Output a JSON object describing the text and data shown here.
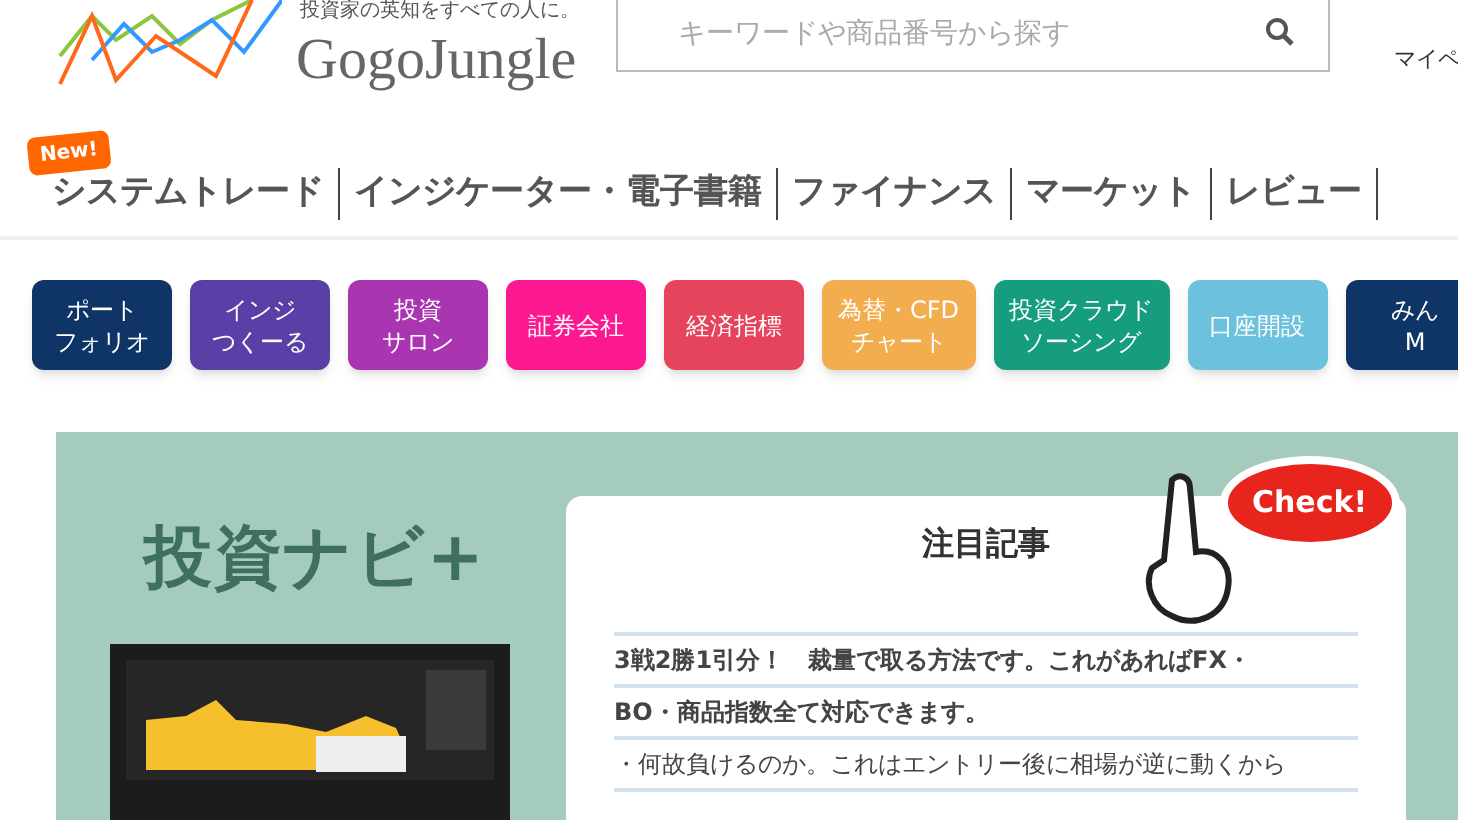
{
  "header": {
    "tagline": "投資家の英知をすべての人に。",
    "logo_text": "GogoJungle",
    "search": {
      "placeholder": "キーワードや商品番号から探す"
    },
    "account_link": "マイペ"
  },
  "nav": {
    "badge": "New!",
    "items": [
      {
        "label": "システムトレード",
        "selected": false
      },
      {
        "label": "インジケーター・電子書籍",
        "selected": false
      },
      {
        "label": "ファイナンス",
        "selected": false
      },
      {
        "label": "マーケット",
        "selected": false
      },
      {
        "label": "レビュー",
        "selected": false
      }
    ]
  },
  "categories": [
    {
      "lines": [
        "ポート",
        "フォリオ"
      ],
      "color": "#0e3566"
    },
    {
      "lines": [
        "インジ",
        "つくーる"
      ],
      "color": "#5a40a6"
    },
    {
      "lines": [
        "投資",
        "サロン"
      ],
      "color": "#a935b0"
    },
    {
      "lines": [
        "証券会社"
      ],
      "color": "#fb1890"
    },
    {
      "lines": [
        "経済指標"
      ],
      "color": "#e6435c"
    },
    {
      "lines": [
        "為替・CFD",
        "チャート"
      ],
      "color": "#f2ad4f"
    },
    {
      "lines": [
        "投資クラウド",
        "ソーシング"
      ],
      "color": "#169d80"
    },
    {
      "lines": [
        "口座開設"
      ],
      "color": "#6cc2dc"
    },
    {
      "lines": [
        "みん",
        "M"
      ],
      "color": "#0e3566"
    }
  ],
  "banner": {
    "title": "投資ナビ+",
    "featured": {
      "heading": "注目記事",
      "badge": "Check!",
      "lines": [
        {
          "text": "3戦2勝1引分！　裁量で取る方法です。これがあればFX・",
          "bold": true
        },
        {
          "text": "BO・商品指数全て対応できます。",
          "bold": true
        },
        {
          "text": "・何故負けるのか。これはエントリー後に相場が逆に動くから",
          "bold": false
        }
      ]
    }
  }
}
